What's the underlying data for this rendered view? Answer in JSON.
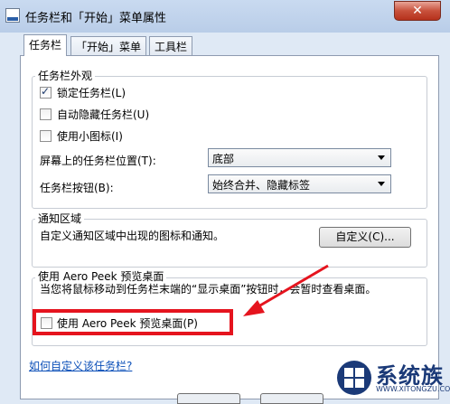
{
  "window": {
    "title": "任务栏和「开始」菜单属性",
    "close_symbol": "✕"
  },
  "tabs": [
    {
      "label": "任务栏",
      "active": true
    },
    {
      "label": "「开始」菜单",
      "active": false
    },
    {
      "label": "工具栏",
      "active": false
    }
  ],
  "appearance": {
    "heading": "任务栏外观",
    "options": [
      {
        "label": "锁定任务栏(L)",
        "checked": true
      },
      {
        "label": "自动隐藏任务栏(U)",
        "checked": false
      },
      {
        "label": "使用小图标(I)",
        "checked": false
      }
    ],
    "position_label": "屏幕上的任务栏位置(T):",
    "position_value": "底部",
    "buttons_label": "任务栏按钮(B):",
    "buttons_value": "始终合并、隐藏标签"
  },
  "notification": {
    "heading": "通知区域",
    "description": "自定义通知区域中出现的图标和通知。",
    "customize_button": "自定义(C)..."
  },
  "aero_peek": {
    "heading": "使用 Aero Peek 预览桌面",
    "description": "当您将鼠标移动到任务栏末端的“显示桌面”按钮时，会暂时查看桌面。",
    "checkbox_label": "使用 Aero Peek 预览桌面(P)",
    "checked": false
  },
  "help_link": "如何自定义该任务栏?",
  "watermark": {
    "name": "系统族",
    "url": "WWW.XITONGZU.COM",
    "accent": "#1b3a78"
  },
  "annotation_color": "#e5141e"
}
